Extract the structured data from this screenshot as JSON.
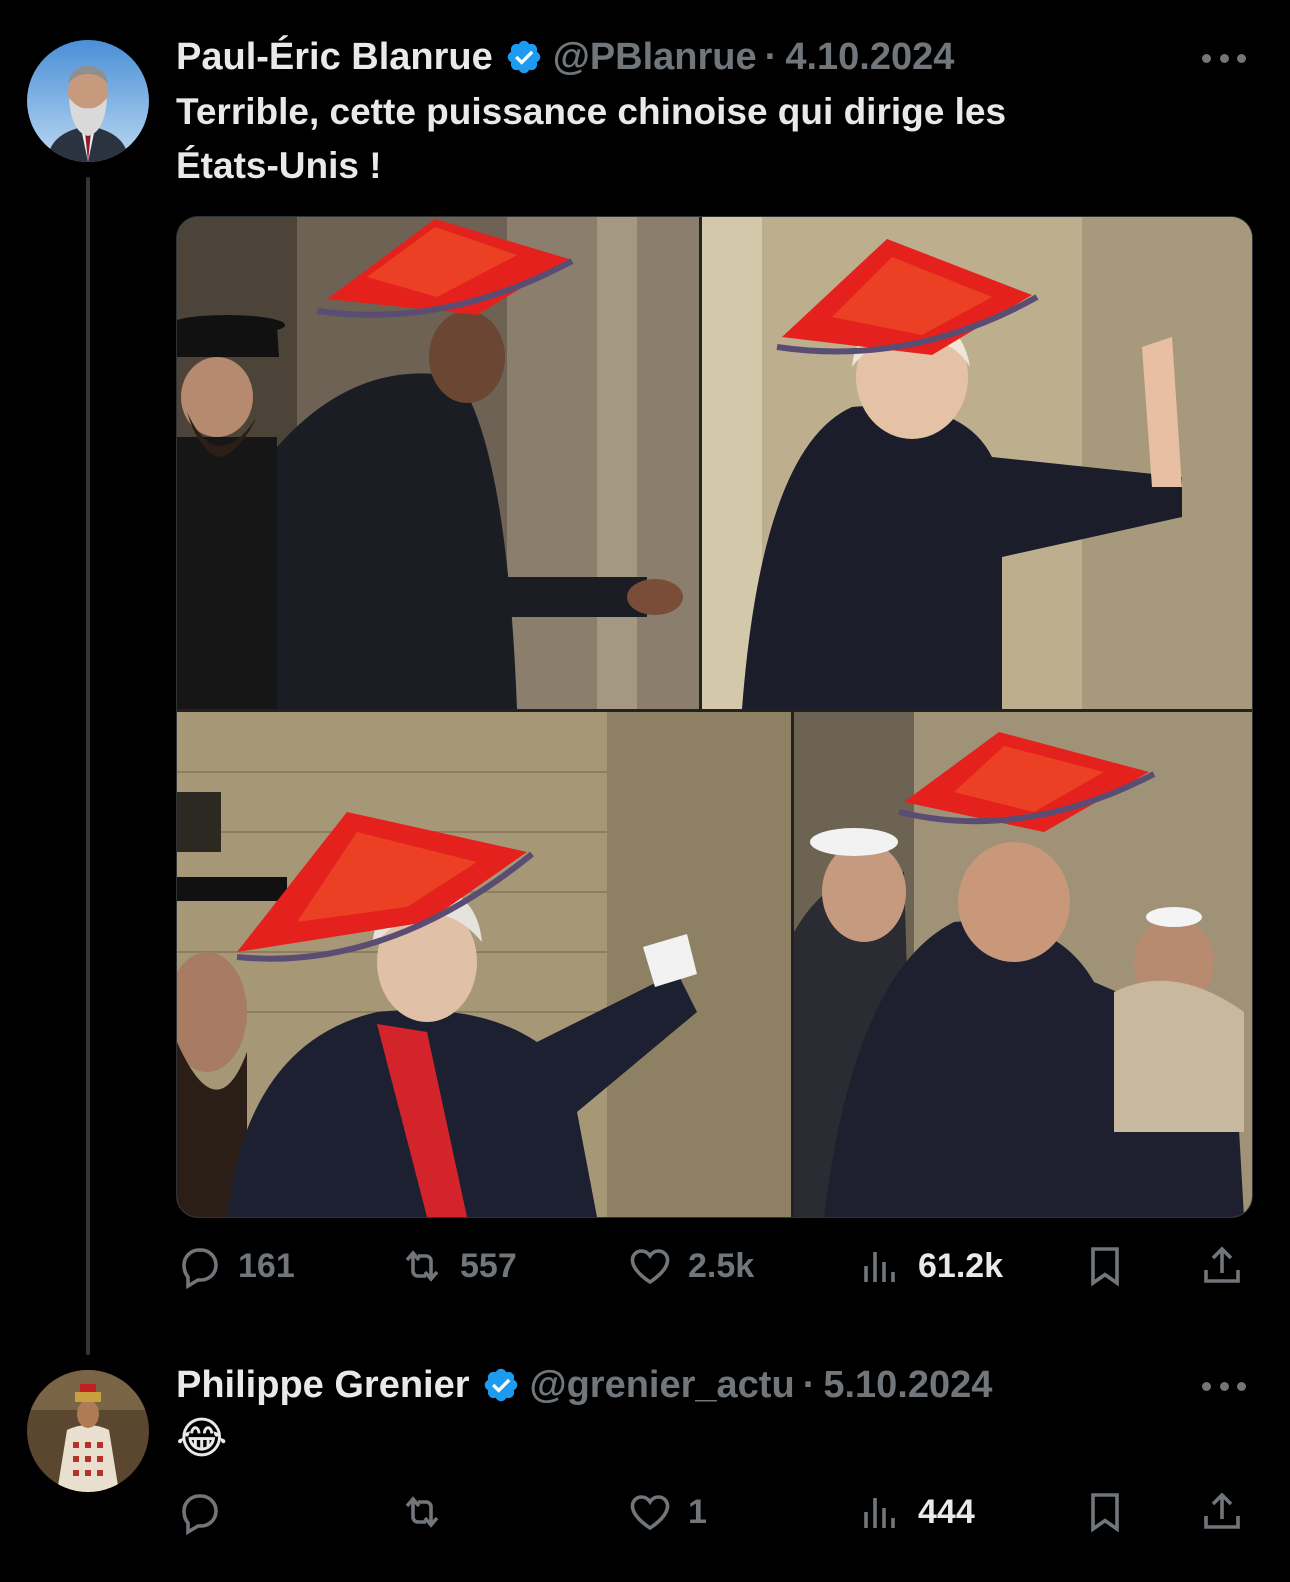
{
  "tweets": [
    {
      "author_name": "Paul-Éric Blanrue",
      "handle": "@PBlanrue",
      "separator": "·",
      "date": "4.10.2024",
      "text_line1": "Terrible, cette puissance chinoise qui dirige les",
      "text_line2": "États-Unis !",
      "verified": true,
      "media": {
        "panels": 4,
        "description_icon": "photo-collage"
      },
      "actions": {
        "replies": "161",
        "reposts": "557",
        "likes": "2.5k",
        "views": "61.2k"
      }
    },
    {
      "author_name": "Philippe Grenier",
      "handle": "@grenier_actu",
      "separator": "·",
      "date": "5.10.2024",
      "text": "😂",
      "verified": true,
      "actions": {
        "replies": "",
        "reposts": "",
        "likes": "1",
        "views": "444"
      }
    }
  ],
  "colors": {
    "background": "#000000",
    "text": "#e7e9ea",
    "muted": "#71767b",
    "verified": "#1d9bf0",
    "hat_red": "#e4211c"
  },
  "icons": {
    "reply": "reply-icon",
    "repost": "repost-icon",
    "like": "like-icon",
    "views": "views-icon",
    "bookmark": "bookmark-icon",
    "share": "share-icon",
    "more": "more-icon",
    "verified": "verified-badge-icon"
  }
}
